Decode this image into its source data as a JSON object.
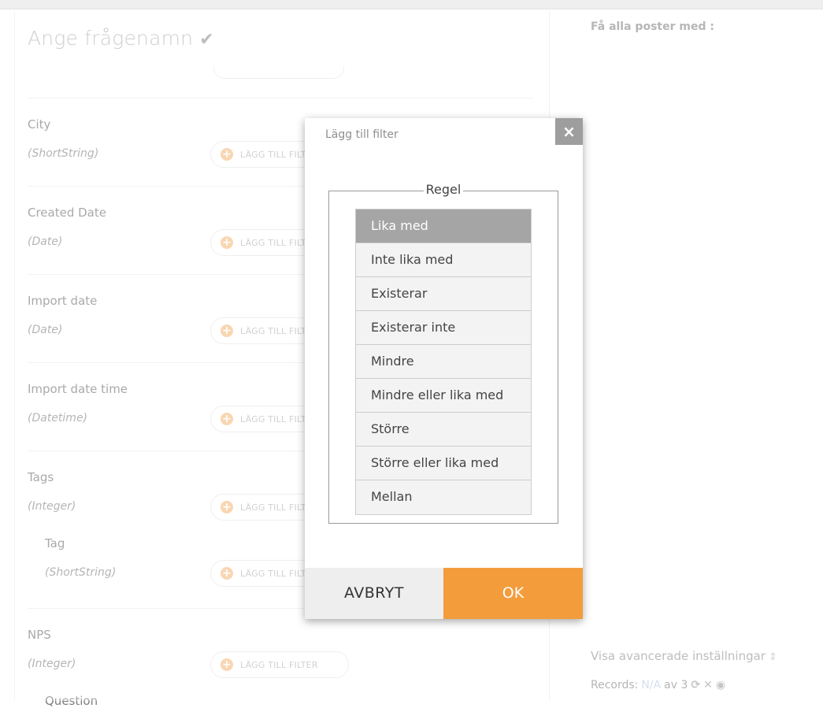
{
  "query_name": {
    "placeholder": "Ange frågenamn",
    "check_icon": "✔"
  },
  "fields": [
    {
      "name": "City",
      "type": "(ShortString)",
      "add_filter": "LÄGG TILL FILTER"
    },
    {
      "name": "Created Date",
      "type": "(Date)",
      "add_filter": "LÄGG TILL FILTER"
    },
    {
      "name": "Import date",
      "type": "(Date)",
      "add_filter": "LÄGG TILL FILTER"
    },
    {
      "name": "Import date time",
      "type": "(Datetime)",
      "add_filter": "LÄGG TILL FILTER"
    },
    {
      "name": "Tags",
      "type": "(Integer)",
      "add_filter": "LÄGG TILL FILTER"
    },
    {
      "name": "Tag",
      "type": "(ShortString)",
      "add_filter": "LÄGG TILL FILTER"
    },
    {
      "name": "NPS",
      "type": "(Integer)",
      "add_filter": "LÄGG TILL FILTER"
    },
    {
      "name": "Question",
      "type": "",
      "add_filter": ""
    }
  ],
  "right_panel": {
    "title": "Få alla poster med :",
    "advanced_settings": "Visa avancerade inställningar",
    "records_label": "Records:",
    "records_value": "N/A",
    "records_of": "av 3"
  },
  "modal": {
    "title": "Lägg till filter",
    "close": "×",
    "legend": "Regel",
    "rules": [
      "Lika med",
      "Inte lika med",
      "Existerar",
      "Existerar inte",
      "Mindre",
      "Mindre eller lika med",
      "Större",
      "Större eller lika med",
      "Mellan"
    ],
    "selected_rule": "Lika med",
    "cancel_label": "AVBRYT",
    "ok_label": "OK"
  },
  "colors": {
    "accent_orange": "#f39c3b",
    "selected_gray": "#a5a5a5",
    "close_gray": "#9e9e9e"
  },
  "icons": [
    "check-icon",
    "plus-circle-icon",
    "close-icon",
    "sort-arrows-icon",
    "refresh-icon",
    "clear-icon",
    "eye-icon"
  ]
}
